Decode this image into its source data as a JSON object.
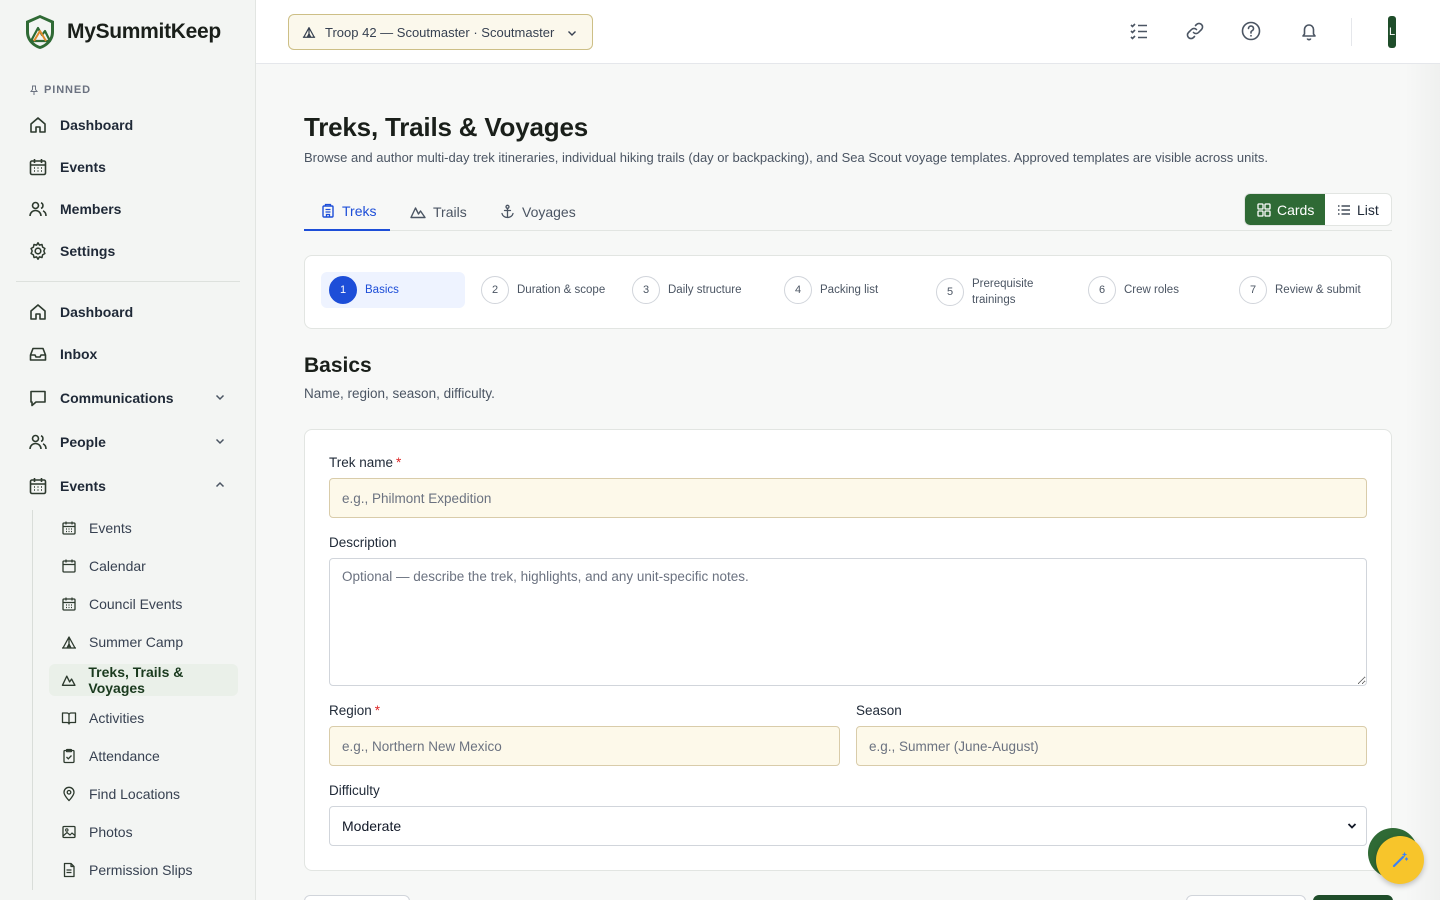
{
  "brand": {
    "name": "MySummitKeep"
  },
  "sidebar": {
    "pinned_label": "PINNED",
    "pinned": [
      {
        "label": "Dashboard",
        "icon": "home-icon"
      },
      {
        "label": "Events",
        "icon": "calendar-icon"
      },
      {
        "label": "Members",
        "icon": "users-icon"
      },
      {
        "label": "Settings",
        "icon": "gear-icon"
      }
    ],
    "main": [
      {
        "label": "Dashboard",
        "icon": "home-icon"
      },
      {
        "label": "Inbox",
        "icon": "inbox-icon"
      },
      {
        "label": "Communications",
        "icon": "chat-icon",
        "expanded": false
      },
      {
        "label": "People",
        "icon": "users-icon",
        "expanded": false
      },
      {
        "label": "Events",
        "icon": "calendar-icon",
        "expanded": true
      }
    ],
    "events_sub": [
      {
        "label": "Events",
        "icon": "calendar-icon"
      },
      {
        "label": "Calendar",
        "icon": "calendar-icon"
      },
      {
        "label": "Council Events",
        "icon": "calendar-icon"
      },
      {
        "label": "Summer Camp",
        "icon": "tent-icon"
      },
      {
        "label": "Treks, Trails & Voyages",
        "icon": "mountain-icon",
        "active": true
      },
      {
        "label": "Activities",
        "icon": "book-icon"
      },
      {
        "label": "Attendance",
        "icon": "clipboard-check-icon"
      },
      {
        "label": "Find Locations",
        "icon": "map-pin-icon"
      },
      {
        "label": "Photos",
        "icon": "image-icon"
      },
      {
        "label": "Permission Slips",
        "icon": "document-icon"
      }
    ]
  },
  "topbar": {
    "unit_selector": "Troop 42 — Scoutmaster · Scoutmaster",
    "avatar_initial": "L"
  },
  "page": {
    "title": "Treks, Trails & Voyages",
    "subtitle": "Browse and author multi-day trek itineraries, individual hiking trails (day or backpacking), and Sea Scout voyage templates. Approved templates are visible across units."
  },
  "tabs": [
    {
      "label": "Treks",
      "icon": "building-icon",
      "active": true
    },
    {
      "label": "Trails",
      "icon": "mountain-icon"
    },
    {
      "label": "Voyages",
      "icon": "anchor-icon"
    }
  ],
  "view_toggle": {
    "cards": "Cards",
    "list": "List",
    "selected": "Cards"
  },
  "steps": [
    {
      "num": "1",
      "label": "Basics",
      "active": true
    },
    {
      "num": "2",
      "label": "Duration & scope"
    },
    {
      "num": "3",
      "label": "Daily structure"
    },
    {
      "num": "4",
      "label": "Packing list"
    },
    {
      "num": "5",
      "label_lines": [
        "Prerequisite",
        "trainings"
      ]
    },
    {
      "num": "6",
      "label": "Crew roles"
    },
    {
      "num": "7",
      "label": "Review & submit"
    }
  ],
  "section": {
    "title": "Basics",
    "subtitle": "Name, region, season, difficulty."
  },
  "form": {
    "trek_name": {
      "label": "Trek name",
      "required": "*",
      "placeholder": "e.g., Philmont Expedition",
      "value": ""
    },
    "description": {
      "label": "Description",
      "placeholder": "Optional — describe the trek, highlights, and any unit-specific notes.",
      "value": ""
    },
    "region": {
      "label": "Region",
      "required": "*",
      "placeholder": "e.g., Northern New Mexico",
      "value": ""
    },
    "season": {
      "label": "Season",
      "placeholder": "e.g., Summer (June-August)",
      "value": ""
    },
    "difficulty": {
      "label": "Difficulty",
      "value": "Moderate"
    }
  },
  "fab": {
    "icon": "wand-icon"
  },
  "colors": {
    "accent": "#2f6a35",
    "link": "#1d4ed8",
    "input_bg": "#fdf9ea"
  }
}
